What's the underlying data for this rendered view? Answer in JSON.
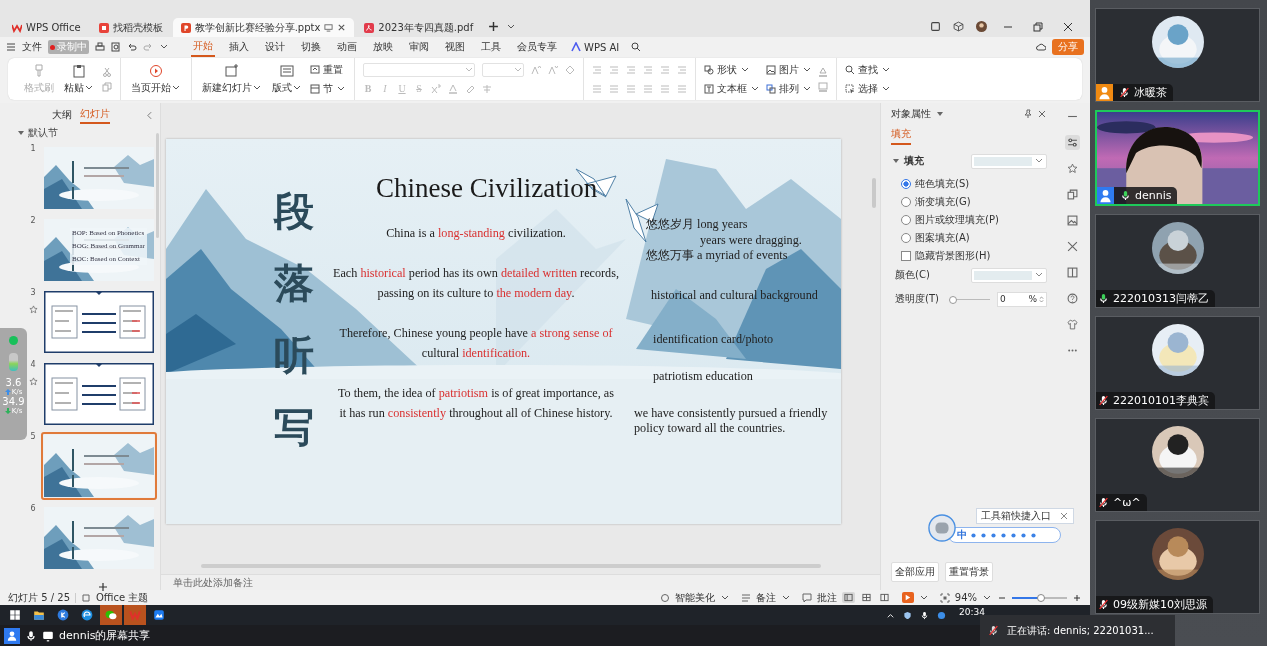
{
  "tabs": [
    {
      "label": "WPS Office",
      "kind": "wps",
      "selected": false
    },
    {
      "label": "找稻壳模板",
      "kind": "docer",
      "selected": false
    },
    {
      "label": "教学创新比赛经验分享.pptx",
      "kind": "ppt",
      "selected": true
    },
    {
      "label": "2023年专四真题.pdf",
      "kind": "pdf",
      "selected": false
    }
  ],
  "menu": {
    "recording": "录制中",
    "file": "文件",
    "items": [
      {
        "label": "开始",
        "selected": true
      },
      {
        "label": "插入",
        "selected": false
      },
      {
        "label": "设计",
        "selected": false
      },
      {
        "label": "切换",
        "selected": false
      },
      {
        "label": "动画",
        "selected": false
      },
      {
        "label": "放映",
        "selected": false
      },
      {
        "label": "审阅",
        "selected": false
      },
      {
        "label": "视图",
        "selected": false
      },
      {
        "label": "工具",
        "selected": false
      },
      {
        "label": "会员专享",
        "selected": false
      }
    ],
    "ai": "WPS AI",
    "share": "分享"
  },
  "ribbon": {
    "format_painter": {
      "label": "格式刷",
      "disabled": true
    },
    "paste": "粘贴",
    "play_current": "当页开始",
    "new_slide": "新建幻灯片",
    "layout": "版式",
    "reset": "重置",
    "section": "节",
    "font_disabled": true,
    "letters": [
      "B",
      "I",
      "U",
      "S"
    ],
    "shape": "形状",
    "picture": "图片",
    "textbox": "文本框",
    "arrange": "排列",
    "find": "查找",
    "select": "选择"
  },
  "slides_panel": {
    "tabs": [
      {
        "label": "大纲",
        "selected": false
      },
      {
        "label": "幻灯片",
        "selected": true
      }
    ],
    "section": "默认节",
    "slides": [
      {
        "number": "1",
        "kind": "landscape",
        "animated": false,
        "selected": false
      },
      {
        "number": "2",
        "kind": "landscape",
        "animated": false,
        "selected": false,
        "lines": [
          "BOP: Based on Phonetics",
          "BOG: Based on Grammar",
          "BOC: Based on Context"
        ]
      },
      {
        "number": "3",
        "kind": "diagram",
        "animated": true,
        "selected": false
      },
      {
        "number": "4",
        "kind": "diagram",
        "animated": true,
        "selected": false
      },
      {
        "number": "5",
        "kind": "landscape",
        "animated": false,
        "selected": true
      },
      {
        "number": "6",
        "kind": "landscape",
        "animated": false,
        "selected": false
      }
    ]
  },
  "slide": {
    "title": "Chinese Civilization",
    "vertical": [
      "段",
      "落",
      "听",
      "写"
    ],
    "paragraphs": [
      {
        "lines": [
          [
            {
              "text": "China is a ",
              "highlight": false
            },
            {
              "text": "long-standing",
              "highlight": true
            },
            {
              "text": " civilization.",
              "highlight": false
            }
          ]
        ]
      },
      {
        "lines": [
          [
            {
              "text": "Each ",
              "highlight": false
            },
            {
              "text": "historical",
              "highlight": true
            },
            {
              "text": " period has its own ",
              "highlight": false
            },
            {
              "text": "detailed written",
              "highlight": true
            },
            {
              "text": " records,",
              "highlight": false
            }
          ],
          [
            {
              "text": "passing on its culture to ",
              "highlight": false
            },
            {
              "text": "the modern day",
              "highlight": true
            },
            {
              "text": ".",
              "highlight": false
            }
          ]
        ]
      },
      {
        "lines": [
          [
            {
              "text": "Therefore, Chinese young people have ",
              "highlight": false
            },
            {
              "text": "a strong sense of",
              "highlight": true
            }
          ],
          [
            {
              "text": "cultural ",
              "highlight": false
            },
            {
              "text": "identification.",
              "highlight": true
            }
          ]
        ]
      },
      {
        "lines": [
          [
            {
              "text": "To them, the idea of ",
              "highlight": false
            },
            {
              "text": "patriotism",
              "highlight": true
            },
            {
              "text": " is of great importance, as",
              "highlight": false
            }
          ],
          [
            {
              "text": "it has run ",
              "highlight": false
            },
            {
              "text": "consistently",
              "highlight": true
            },
            {
              "text": " throughout all of Chinese history.",
              "highlight": false
            }
          ]
        ]
      }
    ],
    "notes": [
      {
        "lines": [
          "悠悠岁月 long years"
        ]
      },
      {
        "lines": [
          "years were dragging."
        ]
      },
      {
        "lines": [
          "悠悠万事 a myriad of events"
        ]
      },
      {
        "lines": [
          "historical and cultural background"
        ]
      },
      {
        "lines": [
          "identification card/photo"
        ]
      },
      {
        "lines": [
          "patriotism education"
        ]
      },
      {
        "lines": [
          "we have consistently pursued a friendly",
          "policy toward all the  countries."
        ]
      }
    ]
  },
  "notes_placeholder": "单击此处添加备注",
  "properties": {
    "title": "对象属性",
    "tabs": [
      {
        "label": "填充",
        "selected": true
      }
    ],
    "section": "填充",
    "expanded": true,
    "options": [
      {
        "label": "纯色填充(S)",
        "kind": "radio",
        "selected": true
      },
      {
        "label": "渐变填充(G)",
        "kind": "radio",
        "selected": false
      },
      {
        "label": "图片或纹理填充(P)",
        "kind": "radio",
        "selected": false
      },
      {
        "label": "图案填充(A)",
        "kind": "radio",
        "selected": false
      },
      {
        "label": "隐藏背景图形(H)",
        "kind": "checkbox",
        "checked": false
      }
    ],
    "color_label": "颜色(C)",
    "transparency_label": "透明度(T)",
    "transparency": {
      "level": 0,
      "value": "0",
      "unit": "%"
    },
    "buttons": [
      "全部应用",
      "重置背景"
    ]
  },
  "ime": {
    "tooltip": "工具箱快捷入口",
    "mode": "中"
  },
  "status": {
    "slide": "幻灯片 5 / 25",
    "theme": "Office 主题",
    "beautify": "智能美化",
    "notes": "备注",
    "comments": "批注",
    "views": [
      {
        "selected": true
      },
      {
        "selected": false
      },
      {
        "selected": false
      }
    ],
    "zoom": "94%",
    "zoom_slider": {
      "level": 0.5
    }
  },
  "network": {
    "up": "3.6",
    "up_unit": "K/s",
    "down": "34.9",
    "down_unit": "K/s"
  },
  "taskbar": {
    "apps": [
      {
        "kind": "start",
        "active": false
      },
      {
        "kind": "folder",
        "active": false
      },
      {
        "kind": "k",
        "active": false
      },
      {
        "kind": "browser",
        "active": false
      },
      {
        "kind": "chat",
        "active": true
      },
      {
        "kind": "wps",
        "active": true
      },
      {
        "kind": "meeting",
        "active": false
      }
    ],
    "time": "20:34"
  },
  "share_bar": "dennis的屏幕共享",
  "participants": [
    {
      "name": "冰暖茶",
      "kind": "avatar",
      "host": true,
      "presenter": false,
      "muted": true,
      "active": false
    },
    {
      "name": "dennis",
      "kind": "video",
      "host": false,
      "presenter": true,
      "muted": false,
      "active": true
    },
    {
      "name": "222010313闫蒂乙",
      "kind": "avatar",
      "host": false,
      "presenter": false,
      "muted": false,
      "active": false
    },
    {
      "name": "222010101李典宾",
      "kind": "avatar",
      "host": false,
      "presenter": false,
      "muted": true,
      "active": false
    },
    {
      "name": "^ω^",
      "kind": "avatar",
      "host": false,
      "presenter": false,
      "muted": true,
      "active": false
    },
    {
      "name": "09级新媒10刘思源",
      "kind": "avatar",
      "host": false,
      "presenter": false,
      "muted": true,
      "active": false
    }
  ],
  "speaking": "正在讲话:  dennis; 22201031..."
}
